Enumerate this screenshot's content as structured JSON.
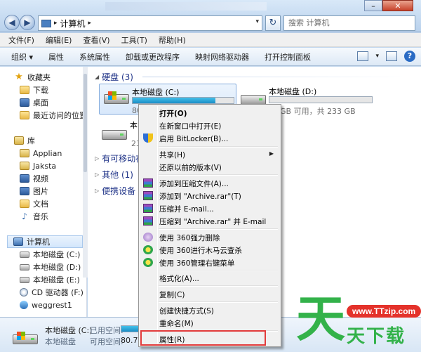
{
  "window": {
    "address_text": "计算机",
    "search_placeholder": "搜索 计算机"
  },
  "menubar": [
    "文件(F)",
    "编辑(E)",
    "查看(V)",
    "工具(T)",
    "帮助(H)"
  ],
  "toolbar": [
    "组织 ▾",
    "属性",
    "系统属性",
    "卸载或更改程序",
    "映射网络驱动器",
    "打开控制面板"
  ],
  "navpane": {
    "favorites": "收藏夹",
    "fav_items": [
      "下载",
      "桌面",
      "最近访问的位置"
    ],
    "library": "库",
    "lib_items": [
      "Applian",
      "Jaksta",
      "视频",
      "图片",
      "文档",
      "音乐"
    ],
    "computer": "计算机",
    "drives": [
      "本地磁盘 (C:)",
      "本地磁盘 (D:)",
      "本地磁盘 (E:)",
      "CD 驱动器 (F:) H",
      "weggrest1"
    ]
  },
  "content": {
    "hdd_group": "硬盘 (3)",
    "removable_group": "有可移动存",
    "other_group": "其他 (1)",
    "portable_group": "便携设备",
    "drive_c": {
      "name": "本地磁盘 (C:)",
      "info": "80.",
      "used_fraction": 0.82
    },
    "drive_d": {
      "name": "本地磁盘 (D:)",
      "info": "GB 可用，共 233 GB",
      "used_fraction": 0.0
    },
    "drive_e": {
      "name": "本",
      "info": "233"
    }
  },
  "context_menu": {
    "open": "打开(O)",
    "open_new": "在新窗口中打开(E)",
    "bitlocker": "启用 BitLocker(B)...",
    "share": "共享(H)",
    "restore": "还原以前的版本(V)",
    "add_archive": "添加到压缩文件(A)...",
    "add_rar": "添加到 \"Archive.rar\"(T)",
    "compress_email": "压缩并 E-mail...",
    "compress_rar_email": "压缩到 \"Archive.rar\" 并 E-mail",
    "del360": "使用 360强力删除",
    "scan360": "使用 360进行木马云查杀",
    "manage360": "使用 360管理右键菜单",
    "format": "格式化(A)...",
    "copy": "复制(C)",
    "shortcut": "创建快捷方式(S)",
    "rename": "重命名(M)",
    "properties": "属性(R)"
  },
  "details": {
    "name": "本地磁盘 (C:)",
    "used_label": "已用空间:",
    "type": "本地磁盘",
    "free_label": "可用空间:",
    "free_value": "80.7 G"
  },
  "watermark": {
    "url": "www.TTzip.com",
    "brand": "天下载"
  }
}
